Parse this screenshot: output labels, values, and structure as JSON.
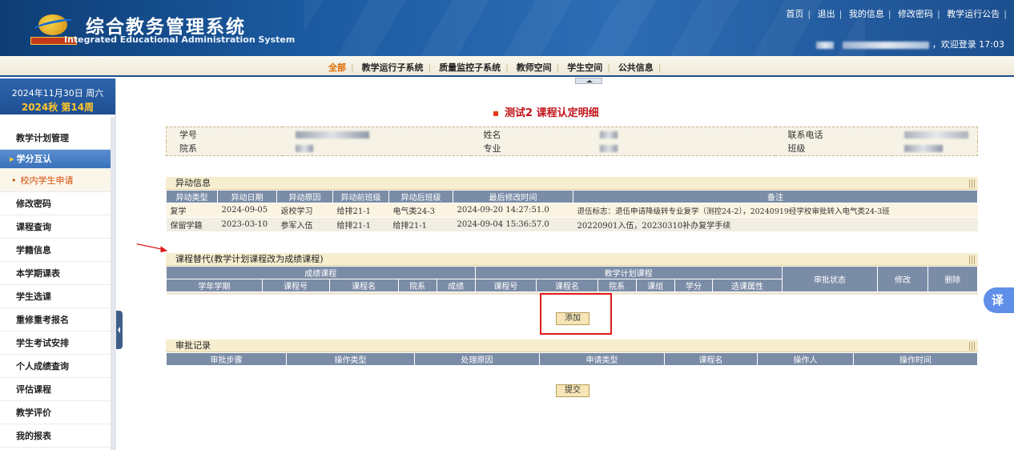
{
  "header": {
    "title_cn": "综合教务管理系统",
    "title_en": "Integrated Educational Administration System",
    "top_links": [
      "首页",
      "退出",
      "我的信息",
      "修改密码",
      "教学运行公告"
    ],
    "welcome": "，欢迎登录 17:03"
  },
  "nav": {
    "items": [
      "全部",
      "教学运行子系统",
      "质量监控子系统",
      "教师空间",
      "学生空间",
      "公共信息"
    ]
  },
  "sidebar": {
    "date": "2024年11月30日  周六",
    "term": "2024秋 第14周",
    "items": [
      {
        "label": "教学计划管理"
      },
      {
        "label": "学分互认"
      },
      {
        "label": "校内学生申请"
      },
      {
        "label": "修改密码"
      },
      {
        "label": "课程查询"
      },
      {
        "label": "学籍信息"
      },
      {
        "label": "本学期课表"
      },
      {
        "label": "学生选课"
      },
      {
        "label": "重修重考报名"
      },
      {
        "label": "学生考试安排"
      },
      {
        "label": "个人成绩查询"
      },
      {
        "label": "评估课程"
      },
      {
        "label": "教学评价"
      },
      {
        "label": "我的报表"
      }
    ]
  },
  "page": {
    "title": "测试2 课程认定明细"
  },
  "info": {
    "labels": {
      "student_no": "学号",
      "name": "姓名",
      "phone": "联系电话",
      "dept": "院系",
      "major": "专业",
      "class": "班级"
    }
  },
  "change_section": {
    "title": "异动信息",
    "headers": [
      "异动类型",
      "异动日期",
      "异动原因",
      "异动前班级",
      "异动后班级",
      "最后修改时间",
      "备注"
    ],
    "rows": [
      [
        "复学",
        "2024-09-05",
        "返校学习",
        "给排21-1",
        "电气类24-3",
        "2024-09-20 14:27:51.0",
        "退伍标志：退伍申请降级转专业复学（测控24-2），20240919经学校审批转入电气类24-3班"
      ],
      [
        "保留学籍",
        "2023-03-10",
        "参军入伍",
        "给排21-1",
        "给排21-1",
        "2024-09-04 15:36:57.0",
        "20220901入伍，20230310补办复学手续"
      ]
    ]
  },
  "replace_section": {
    "title": "课程替代(教学计划课程改为成绩课程)",
    "group_score": "成绩课程",
    "group_plan": "教学计划课程",
    "headers_score": [
      "学年学期",
      "课程号",
      "课程名",
      "院系",
      "成绩"
    ],
    "headers_plan": [
      "课程号",
      "课程名",
      "院系",
      "课组",
      "学分",
      "选课属性"
    ],
    "headers_ops": [
      "审批状态",
      "修改",
      "删除"
    ],
    "add_button": "添加"
  },
  "approval_section": {
    "title": "审批记录",
    "headers": [
      "审批步骤",
      "操作类型",
      "处理原因",
      "申请类型",
      "课程名",
      "操作人",
      "操作时间"
    ],
    "submit_button": "提交"
  },
  "translate_label": "译",
  "colors": {
    "accent": "#c0141a",
    "header_blue": "#1b5aa0",
    "table_head": "#7b8ca6",
    "highlight_box": "#e11b1b"
  }
}
